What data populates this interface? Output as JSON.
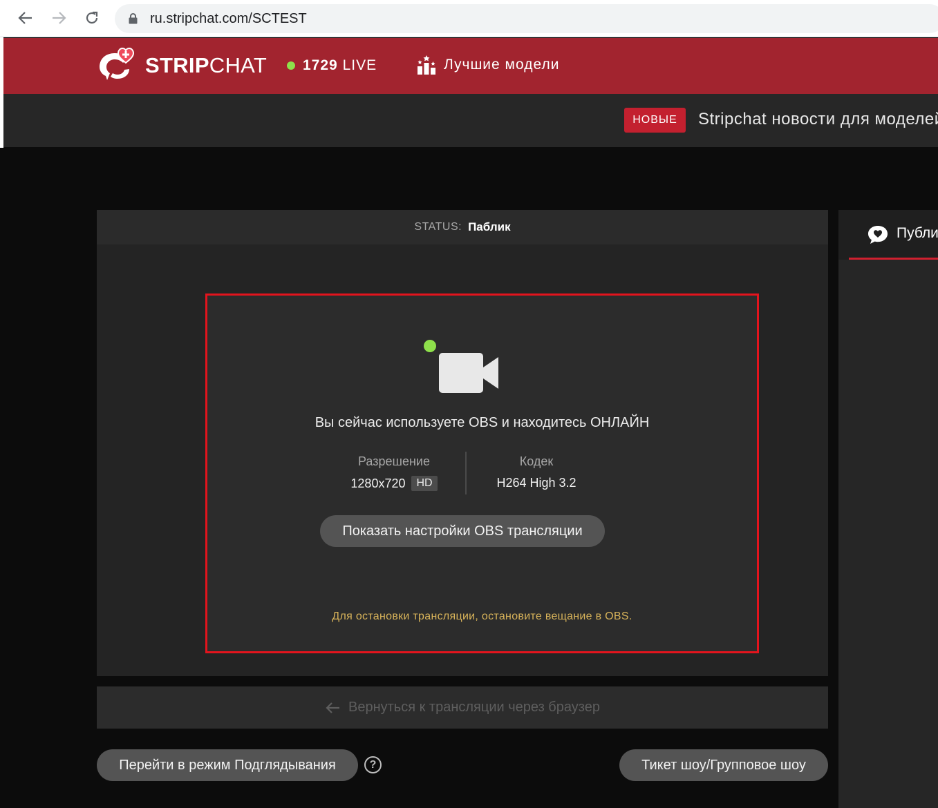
{
  "browser": {
    "url": "ru.stripchat.com/SCTEST"
  },
  "header": {
    "logo_text_bold": "STRIP",
    "logo_text_regular": "CHAT",
    "live_count": "1729",
    "live_label": "LIVE",
    "top_models_label": "Лучшие модели",
    "background_color": "#a2242f"
  },
  "news": {
    "badge": "НОВЫЕ",
    "text": "Stripchat новости для моделей"
  },
  "status": {
    "label": "STATUS:",
    "value": "Паблик"
  },
  "obs": {
    "message": "Вы сейчас используете OBS и находитесь ОНЛАЙН",
    "resolution_label": "Разрешение",
    "resolution_value": "1280x720",
    "resolution_badge": "HD",
    "codec_label": "Кодек",
    "codec_value": "H264 High 3.2",
    "settings_button": "Показать настройки OBS трансляции",
    "stop_note": "Для остановки трансляции, остановите вещание в OBS.",
    "online_indicator_color": "#8ee04b",
    "highlight_border_color": "#e3141d"
  },
  "back_to_browser": {
    "label": "Вернуться к трансляции через браузер"
  },
  "actions": {
    "spy_mode_button": "Перейти в режим Подглядывания",
    "help_icon": "?",
    "ticket_show_button": "Тикет шоу/Групповое шоу"
  },
  "chat": {
    "tab_label": "Публичный чат",
    "tab_icon": "chat-bubble-icon"
  }
}
